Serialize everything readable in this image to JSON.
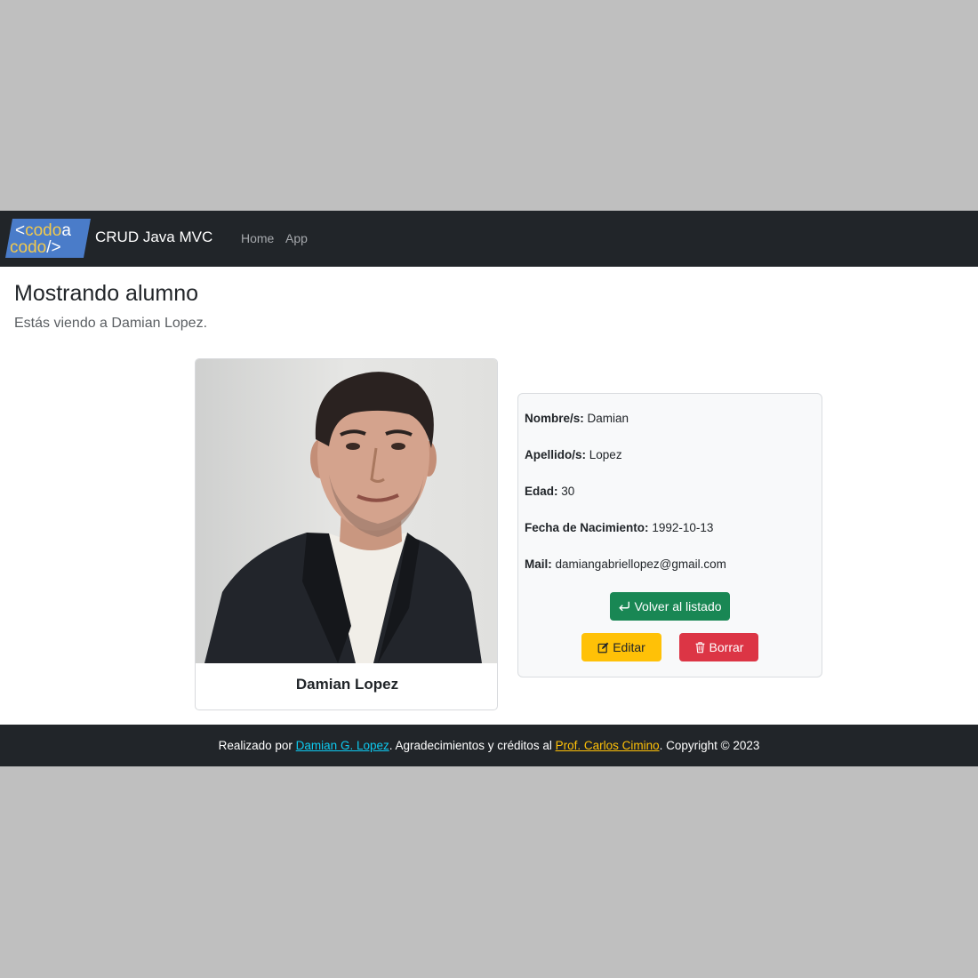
{
  "navbar": {
    "logo": {
      "line1_prefix": "<",
      "line1_word": "codo",
      "line1_suffix": "a",
      "line2_word": "codo",
      "line2_suffix": "/>"
    },
    "brand": "CRUD Java MVC",
    "links": [
      {
        "label": "Home"
      },
      {
        "label": "App"
      }
    ]
  },
  "main": {
    "title": "Mostrando alumno",
    "subtitle": "Estás viendo a Damian Lopez."
  },
  "profile": {
    "name": "Damian Lopez",
    "fields": [
      {
        "label": "Nombre/s:",
        "value": "Damian"
      },
      {
        "label": "Apellido/s:",
        "value": "Lopez"
      },
      {
        "label": "Edad:",
        "value": "30"
      },
      {
        "label": "Fecha de Nacimiento:",
        "value": "1992-10-13"
      },
      {
        "label": "Mail:",
        "value": "damiangabriellopez@gmail.com"
      }
    ]
  },
  "actions": {
    "back_label": "Volver al listado",
    "edit_label": "Editar",
    "delete_label": "Borrar"
  },
  "footer": {
    "text1": "Realizado por ",
    "author_link": "Damian G. Lopez",
    "text2": ". Agradecimientos y créditos al ",
    "credit_link": "Prof. Carlos Cimino",
    "text3": ". Copyright © 2023"
  },
  "colors": {
    "navbar_bg": "#212529",
    "success": "#198754",
    "warning": "#ffc107",
    "danger": "#dc3545",
    "info": "#0dcaf0",
    "logo_blue": "#4a7cc9",
    "logo_yellow": "#f2c94c"
  },
  "icons": {
    "back": "arrow-return-left-icon",
    "edit": "pencil-square-icon",
    "delete": "trash-icon"
  }
}
